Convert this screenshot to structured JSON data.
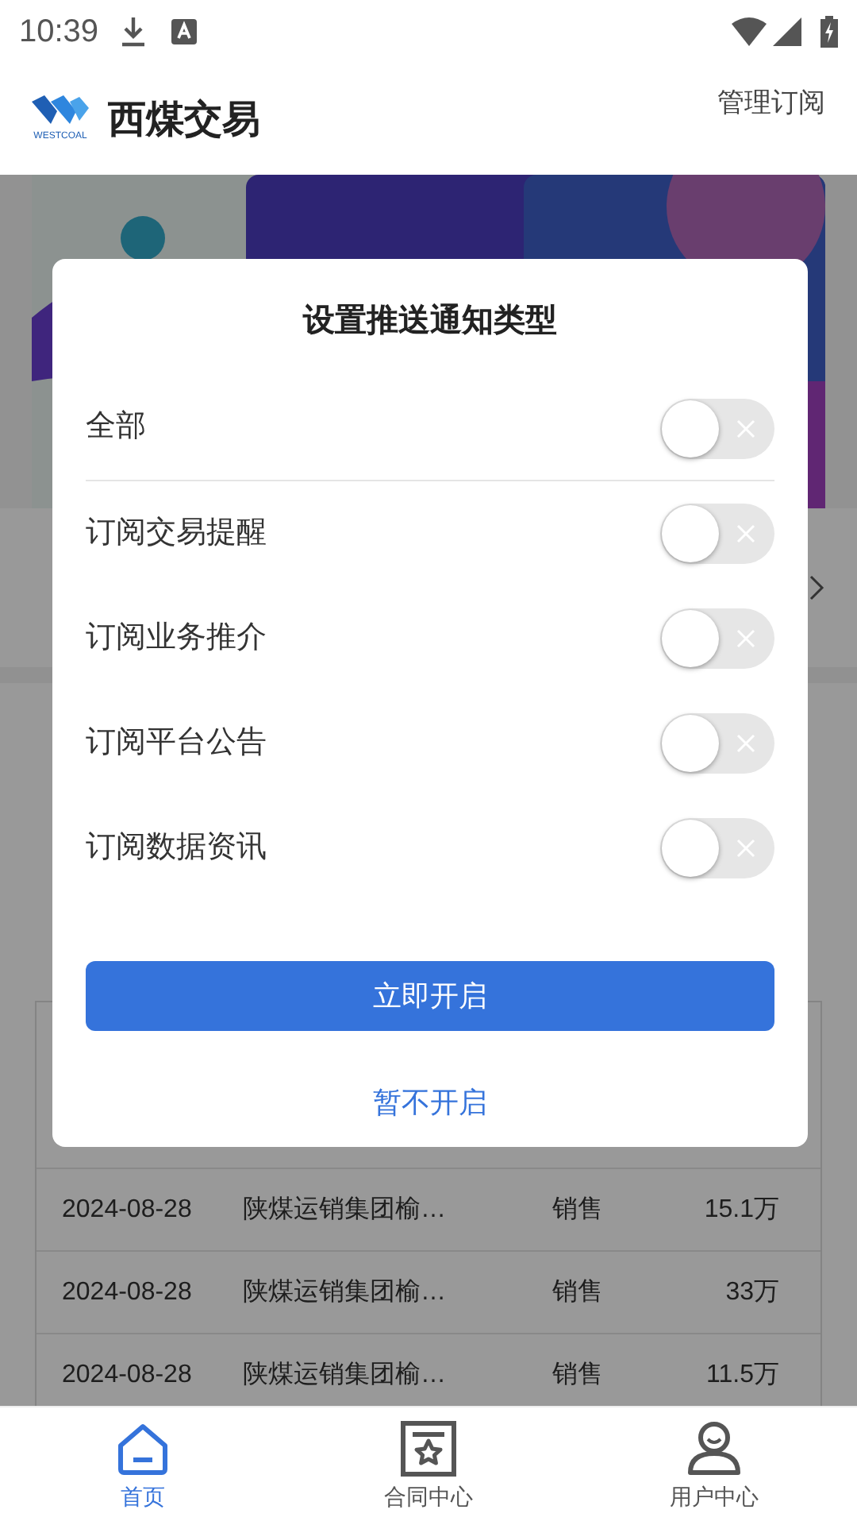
{
  "status_bar": {
    "time": "10:39"
  },
  "header": {
    "logo_text": "WESTCOAL",
    "title": "西煤交易",
    "action": "管理订阅"
  },
  "table": {
    "rows": [
      {
        "date": "2024-08-28",
        "company": "陕煤运销集团榆…",
        "type": "销售",
        "amount": "15.1万"
      },
      {
        "date": "2024-08-28",
        "company": "陕煤运销集团榆…",
        "type": "销售",
        "amount": "33万"
      },
      {
        "date": "2024-08-28",
        "company": "陕煤运销集团榆…",
        "type": "销售",
        "amount": "11.5万"
      }
    ]
  },
  "dialog": {
    "title": "设置推送通知类型",
    "options": [
      {
        "label": "全部",
        "on": false
      },
      {
        "label": "订阅交易提醒",
        "on": false
      },
      {
        "label": "订阅业务推介",
        "on": false
      },
      {
        "label": "订阅平台公告",
        "on": false
      },
      {
        "label": "订阅数据资讯",
        "on": false
      }
    ],
    "confirm": "立即开启",
    "cancel": "暂不开启"
  },
  "tab_bar": {
    "items": [
      {
        "label": "首页",
        "selected": true,
        "kind": "home"
      },
      {
        "label": "合同中心",
        "selected": false,
        "kind": "contract"
      },
      {
        "label": "用户中心",
        "selected": false,
        "kind": "user"
      }
    ]
  }
}
